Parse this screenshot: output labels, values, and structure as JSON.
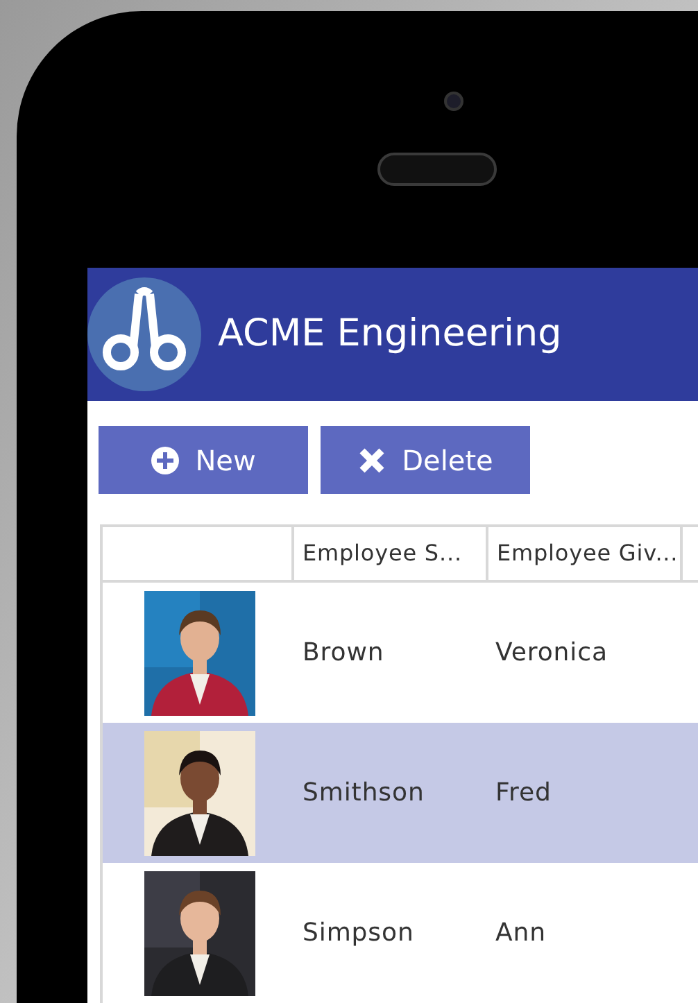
{
  "app": {
    "title": "ACME Engineering"
  },
  "toolbar": [
    {
      "kind": "new",
      "label": "New"
    },
    {
      "kind": "delete",
      "label": "Delete"
    }
  ],
  "table": {
    "columns": [
      "Employee S...",
      "Employee Giv..."
    ],
    "rows": [
      {
        "surname": "Brown",
        "given_name": "Veronica",
        "selected": false
      },
      {
        "surname": "Smithson",
        "given_name": "Fred",
        "selected": true
      },
      {
        "surname": "Simpson",
        "given_name": "Ann",
        "selected": false
      }
    ]
  }
}
